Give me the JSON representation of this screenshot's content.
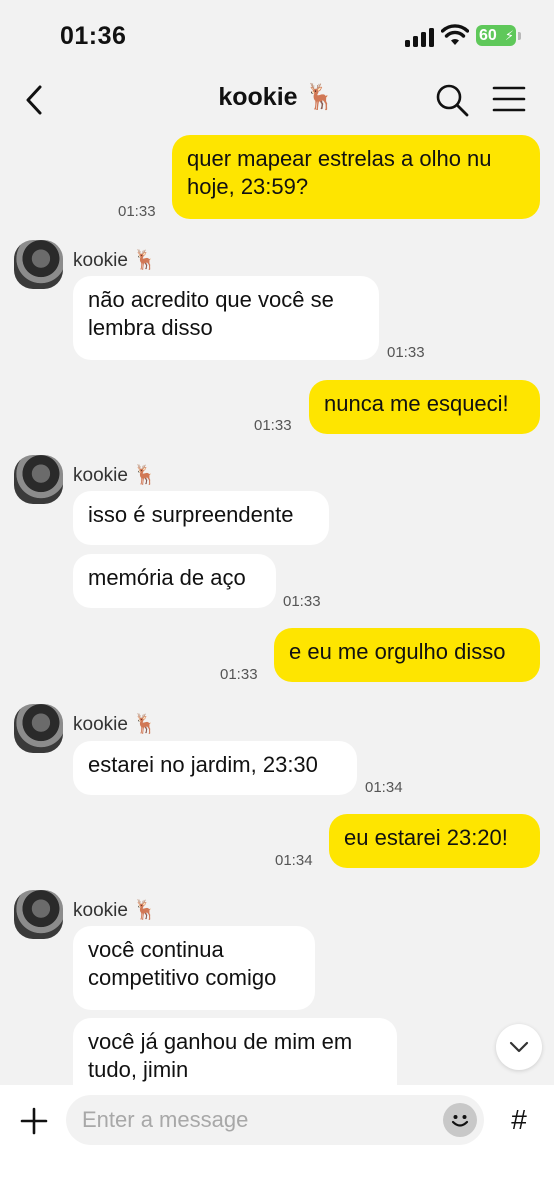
{
  "status_bar": {
    "time": "01:36",
    "battery": "60"
  },
  "header": {
    "title": "kookie",
    "title_emoji": "🦌"
  },
  "messages": [
    {
      "from": "me",
      "lines": [
        "quer mapear estrelas a olho nu",
        "hoje, 23:59?"
      ],
      "time": "01:33"
    },
    {
      "from": "them",
      "sender": "kookie 🦌",
      "lines": [
        "não acredito que você se",
        "lembra disso"
      ],
      "time": "01:33"
    },
    {
      "from": "me",
      "lines": [
        "nunca me esqueci!"
      ],
      "time": "01:33"
    },
    {
      "from": "them",
      "sender": "kookie 🦌",
      "lines": [
        "isso é surpreendente"
      ]
    },
    {
      "from": "them",
      "lines": [
        "memória de aço"
      ],
      "time": "01:33"
    },
    {
      "from": "me",
      "lines": [
        "e eu me orgulho disso"
      ],
      "time": "01:33"
    },
    {
      "from": "them",
      "sender": "kookie 🦌",
      "lines": [
        "estarei no jardim, 23:30"
      ],
      "time": "01:34"
    },
    {
      "from": "me",
      "lines": [
        "eu estarei 23:20!"
      ],
      "time": "01:34"
    },
    {
      "from": "them",
      "sender": "kookie 🦌",
      "lines": [
        "você continua",
        "competitivo comigo"
      ]
    },
    {
      "from": "them",
      "lines": [
        "você já ganhou de mim em",
        "tudo, jimin"
      ]
    }
  ],
  "input": {
    "placeholder": "Enter a message",
    "value": ""
  },
  "icons": {
    "back": "chevron-left-icon",
    "search": "search-icon",
    "menu": "hamburger-menu-icon",
    "plus": "plus-icon",
    "emoji": "smiley-icon",
    "hash": "hash-icon",
    "scroll": "chevron-down-icon"
  },
  "colors": {
    "my_bubble": "#fee500",
    "their_bubble": "#ffffff",
    "background": "#f2f2f2",
    "battery": "#5fc85a"
  }
}
